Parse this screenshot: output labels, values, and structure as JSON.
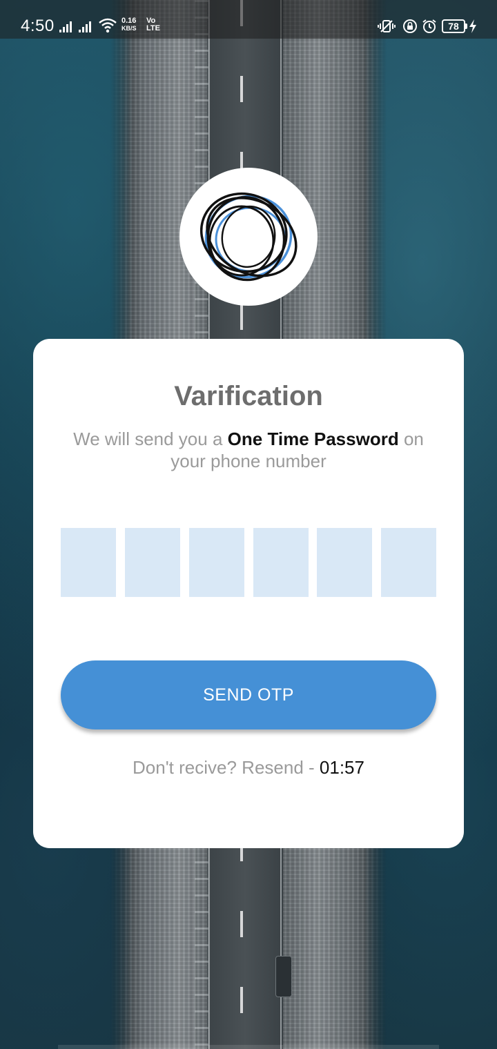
{
  "status_bar": {
    "time": "4:50",
    "net_speed_value": "0.16",
    "net_speed_unit": "KB/S",
    "volte_top": "Vo",
    "volte_bottom": "LTE",
    "battery": "78",
    "icons": [
      "signal-icon",
      "signal-icon",
      "wifi-icon",
      "vibrate-icon",
      "lock-rotation-icon",
      "alarm-icon",
      "battery-icon",
      "charging-icon"
    ]
  },
  "logo": {
    "icon": "rings-logo",
    "colors": {
      "dark": "#111111",
      "accent": "#4a90d9"
    }
  },
  "card": {
    "title": "Varification",
    "subtitle_pre": "We will send you a",
    "subtitle_bold": "One Time Password",
    "subtitle_post": "on your phone number",
    "otp_digits": [
      "",
      "",
      "",
      "",
      "",
      ""
    ],
    "send_button": "SEND OTP",
    "resend_text": "Don't recive? Resend -",
    "timer": "01:57"
  },
  "colors": {
    "primary": "#4590d6",
    "otp_box": "#d9e8f6",
    "title": "#6d6d6d",
    "muted": "#9a9a9a"
  }
}
